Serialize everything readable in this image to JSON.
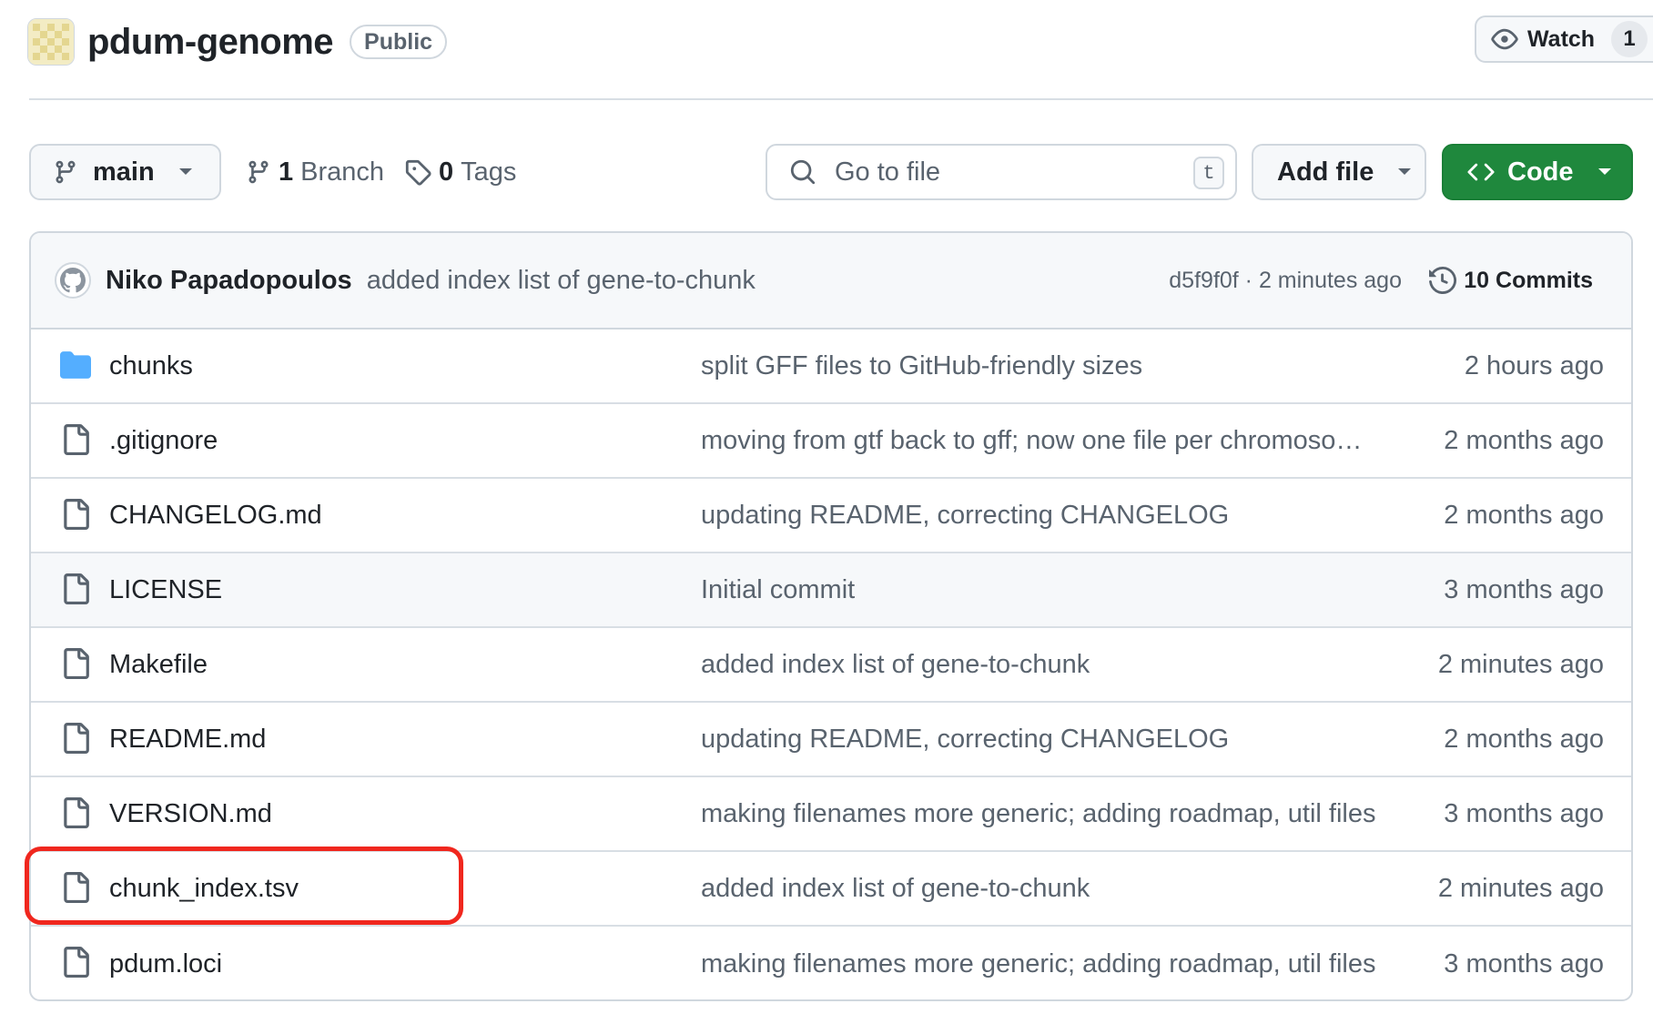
{
  "repo": {
    "name": "pdum-genome",
    "visibility": "Public",
    "watch_label": "Watch",
    "watch_count": "1"
  },
  "toolbar": {
    "branch": "main",
    "branches_count": "1",
    "branches_label": "Branch",
    "tags_count": "0",
    "tags_label": "Tags",
    "search_placeholder": "Go to file",
    "search_shortcut": "t",
    "add_file_label": "Add file",
    "code_label": "Code",
    "code_color": "#1f883d"
  },
  "latest_commit": {
    "author": "Niko Papadopoulos",
    "message": "added index list of gene-to-chunk",
    "meta": "d5f9f0f · 2 minutes ago",
    "commits_label": "10 Commits"
  },
  "files": [
    {
      "name": "chunks",
      "type": "folder",
      "message": "split GFF files to GitHub-friendly sizes",
      "time": "2 hours ago"
    },
    {
      "name": ".gitignore",
      "type": "file",
      "message": "moving from gtf back to gff; now one file per chromoso…",
      "time": "2 months ago"
    },
    {
      "name": "CHANGELOG.md",
      "type": "file",
      "message": "updating README, correcting CHANGELOG",
      "time": "2 months ago"
    },
    {
      "name": "LICENSE",
      "type": "file",
      "message": "Initial commit",
      "time": "3 months ago"
    },
    {
      "name": "Makefile",
      "type": "file",
      "message": "added index list of gene-to-chunk",
      "time": "2 minutes ago"
    },
    {
      "name": "README.md",
      "type": "file",
      "message": "updating README, correcting CHANGELOG",
      "time": "2 months ago"
    },
    {
      "name": "VERSION.md",
      "type": "file",
      "message": "making filenames more generic; adding roadmap, util files",
      "time": "3 months ago"
    },
    {
      "name": "chunk_index.tsv",
      "type": "file",
      "message": "added index list of gene-to-chunk",
      "time": "2 minutes ago"
    },
    {
      "name": "pdum.loci",
      "type": "file",
      "message": "making filenames more generic; adding roadmap, util files",
      "time": "3 months ago"
    }
  ],
  "annotation": {
    "highlighted_file": "chunk_index.tsv",
    "color": "#f0271e"
  }
}
